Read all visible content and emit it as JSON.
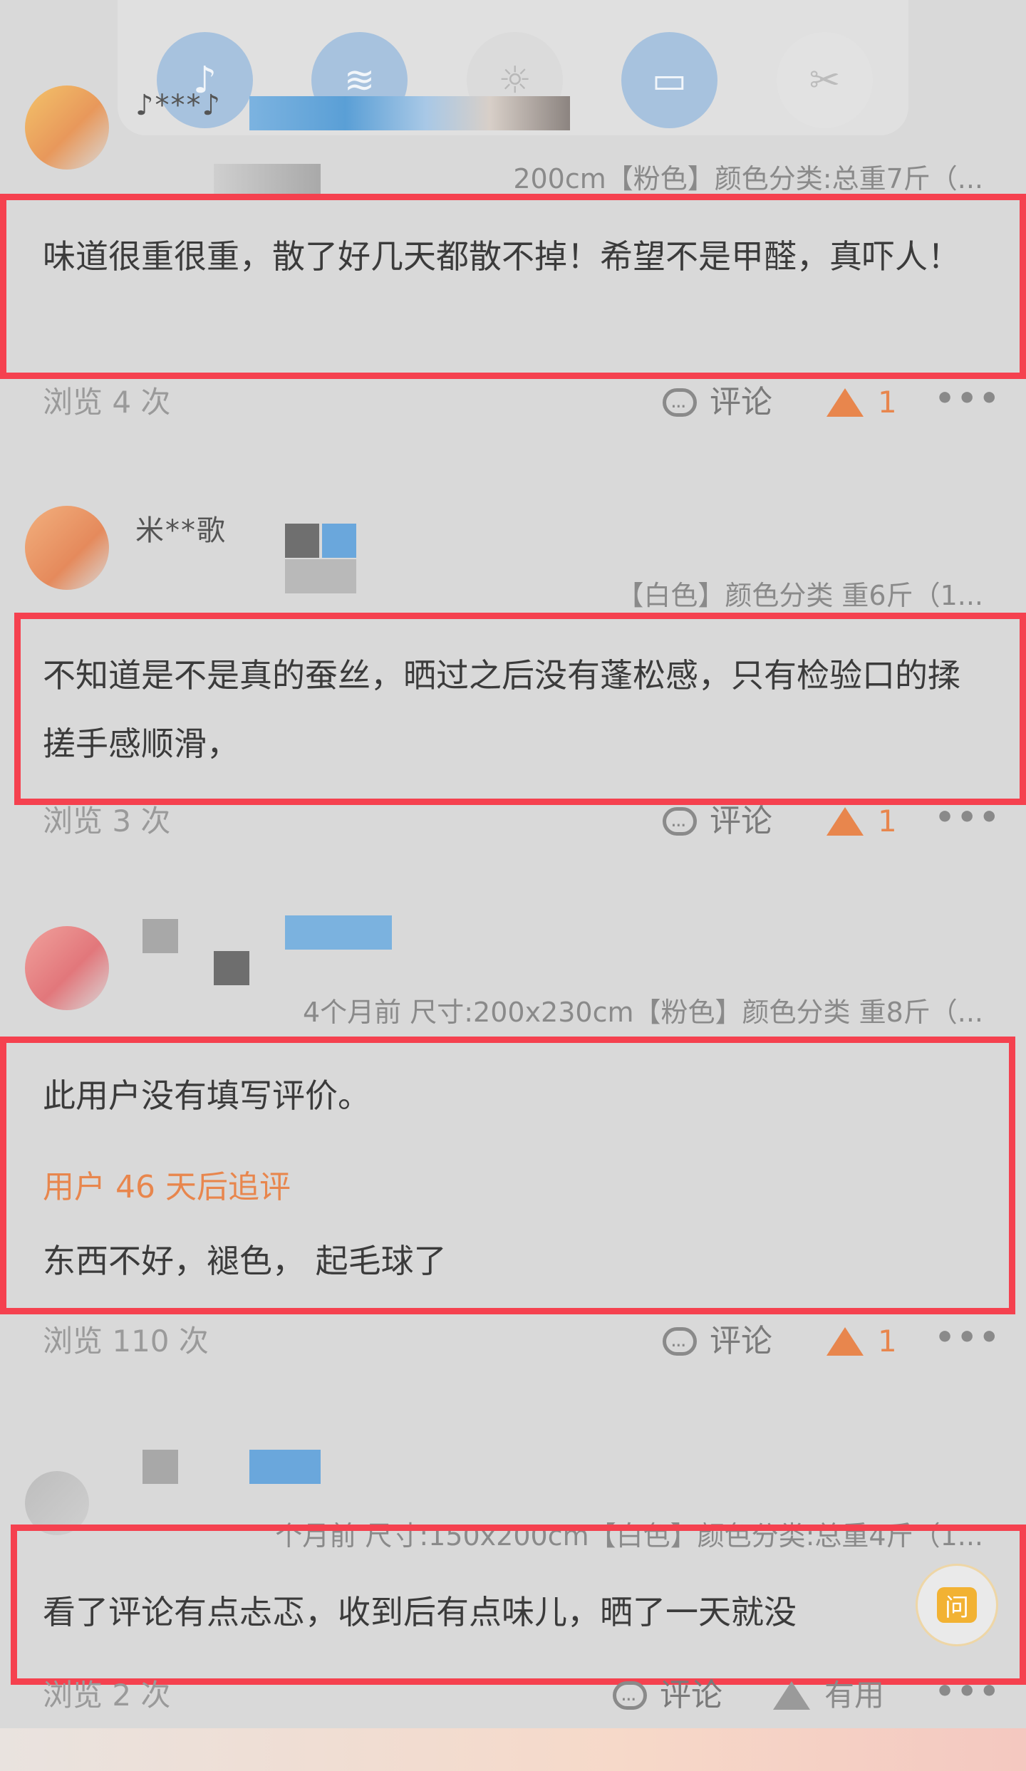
{
  "quick_settings_ghost": {
    "icons": [
      "sound-vibrate-icon",
      "wifi-icon",
      "brightness-icon",
      "book-icon",
      "screenshot-icon"
    ]
  },
  "reviews": [
    {
      "username": "♪***♪",
      "meta": "200cm【粉色】颜色分类:总重7斤（...",
      "content": "味道很重很重，散了好几天都散不掉！希望不是甲醛，真吓人！",
      "views": "浏览 4 次",
      "comment_label": "评论",
      "like_count": "1"
    },
    {
      "username": "米**歌",
      "meta": "【白色】颜色分类    重6斤（1...",
      "content": "不知道是不是真的蚕丝，晒过之后没有蓬松感，只有检验口的揉搓手感顺滑，",
      "views": "浏览 3 次",
      "comment_label": "评论",
      "like_count": "1"
    },
    {
      "username": "",
      "meta": "4个月前 尺寸:200x230cm【粉色】颜色分类    重8斤（...",
      "content": "此用户没有填写评价。",
      "followup_label": "用户 46 天后追评",
      "followup_content": "东西不好，褪色，  起毛球了",
      "views": "浏览 110 次",
      "comment_label": "评论",
      "like_count": "1"
    },
    {
      "username": "",
      "meta": "个月前 尺寸:150x200cm【白色】颜色分类:总重4斤（1...",
      "content": "看了评论有点忐忑，收到后有点味儿，晒了一天就没",
      "views": "浏览 2 次",
      "comment_label": "评论",
      "like_label": "有用"
    }
  ],
  "ask_button": {
    "label": "问"
  },
  "colors": {
    "highlight_box": "#f5414f",
    "accent_orange": "#e8864d",
    "background": "#d9d9d9"
  }
}
